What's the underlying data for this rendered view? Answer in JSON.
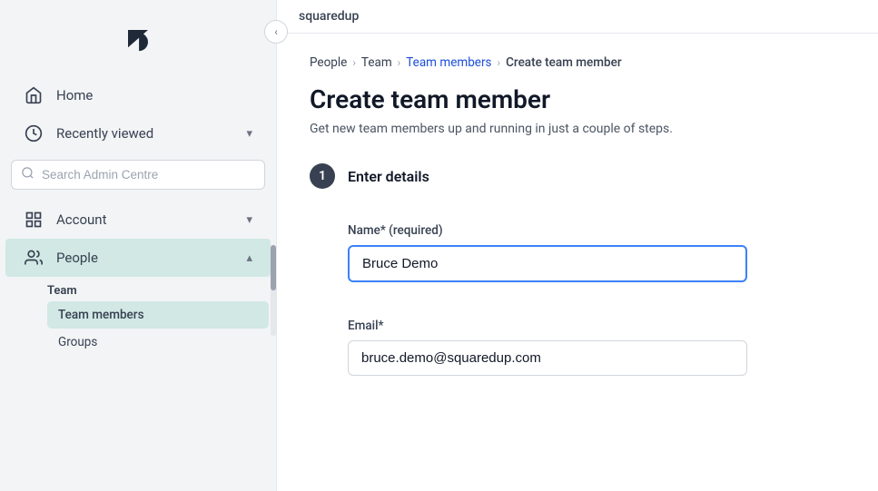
{
  "sidebar": {
    "logo_alt": "Zendesk logo",
    "app_name": "squaredup",
    "nav_items": [
      {
        "id": "home",
        "label": "Home",
        "icon": "home-icon",
        "active": false,
        "has_chevron": false
      },
      {
        "id": "recently-viewed",
        "label": "Recently viewed",
        "icon": "clock-icon",
        "active": false,
        "has_chevron": true,
        "chevron_dir": "down"
      }
    ],
    "search_placeholder": "Search Admin Centre",
    "section_account": {
      "label": "Account",
      "icon": "account-icon",
      "active": false,
      "has_chevron": true,
      "chevron_dir": "down"
    },
    "section_people": {
      "label": "People",
      "icon": "people-icon",
      "active": true,
      "has_chevron": true,
      "chevron_dir": "up",
      "subsections": [
        {
          "label": "Team",
          "items": [
            {
              "label": "Team members",
              "active": true
            },
            {
              "label": "Groups",
              "active": false
            }
          ]
        }
      ]
    }
  },
  "topbar": {
    "app_name": "squaredup"
  },
  "breadcrumb": {
    "items": [
      "People",
      "Team",
      "Team members",
      "Create team member"
    ],
    "separators": [
      ">",
      ">",
      ">"
    ]
  },
  "page": {
    "title": "Create team member",
    "subtitle": "Get new team members up and running in just a couple of steps."
  },
  "steps": [
    {
      "number": "1",
      "title": "Enter details",
      "fields": [
        {
          "id": "name",
          "label": "Name* (required)",
          "value": "Bruce Demo",
          "placeholder": "",
          "active": true
        },
        {
          "id": "email",
          "label": "Email*",
          "value": "bruce.demo@squaredup.com",
          "placeholder": "",
          "active": false
        }
      ]
    }
  ],
  "collapse_btn_label": "‹"
}
